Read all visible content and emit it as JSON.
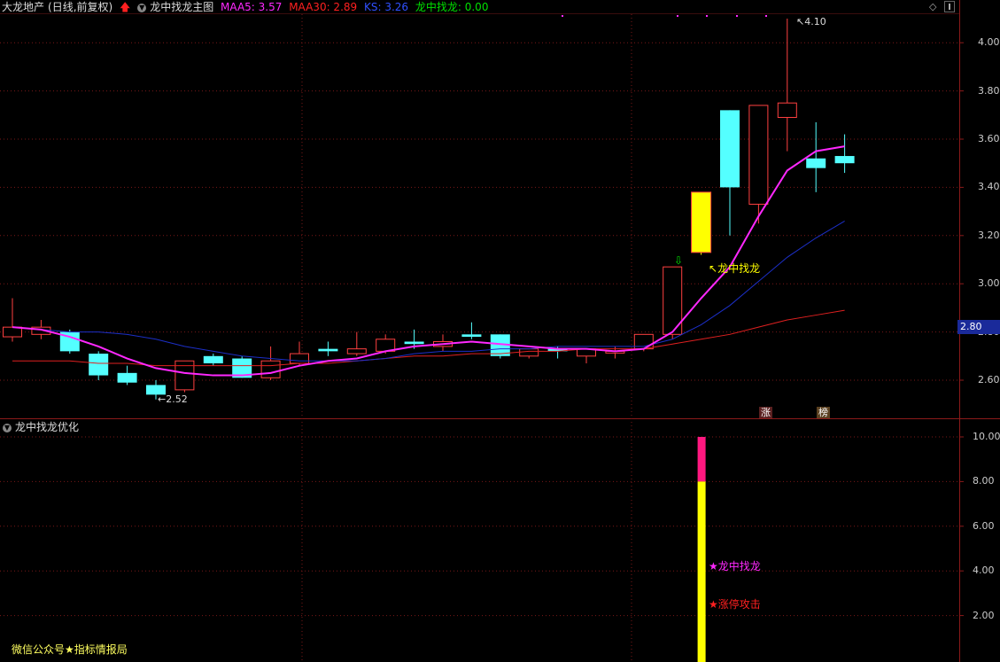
{
  "main_panel": {
    "stock_name": "大龙地产",
    "period": "(日线,前复权)",
    "indicator_name": "龙中找龙主图",
    "maa5_label": "MAA5: 3.57",
    "maa30_label": "MAA30: 2.89",
    "ks_label": "KS: 3.26",
    "signal_label": "龙中找龙: 0.00",
    "current_price_tag": "2.80",
    "annotation_high": "4.10",
    "annotation_low": "2.52",
    "signal_text": "龙中找龙",
    "badge_zhang": "涨",
    "badge_bang": "榜",
    "y_ticks": [
      "4.00",
      "3.80",
      "3.60",
      "3.40",
      "3.20",
      "3.00",
      "2.80",
      "2.60"
    ]
  },
  "sub_panel": {
    "indicator_name": "龙中找龙优化",
    "label_signal": "★龙中找龙",
    "label_limit_up": "★涨停攻击",
    "watermark": "微信公众号★指标情报局",
    "y_ticks": [
      "10.00",
      "8.00",
      "6.00",
      "4.00",
      "2.00"
    ]
  },
  "colors": {
    "up": "#ff4040",
    "down": "#54ffff",
    "maa5": "#ff28ff",
    "maa30": "#e02020",
    "ks": "#1c2fc8",
    "signal": "#00e000",
    "yellow": "#ffff00",
    "magenta_bar": "#ff1880"
  },
  "chart_data": {
    "type": "candlestick",
    "ylim": [
      2.45,
      4.15
    ],
    "candles": [
      {
        "o": 2.78,
        "c": 2.82,
        "h": 2.94,
        "l": 2.76
      },
      {
        "o": 2.79,
        "c": 2.82,
        "h": 2.85,
        "l": 2.77
      },
      {
        "o": 2.8,
        "c": 2.72,
        "h": 2.81,
        "l": 2.71
      },
      {
        "o": 2.71,
        "c": 2.62,
        "h": 2.72,
        "l": 2.6
      },
      {
        "o": 2.63,
        "c": 2.59,
        "h": 2.66,
        "l": 2.58
      },
      {
        "o": 2.58,
        "c": 2.54,
        "h": 2.6,
        "l": 2.52
      },
      {
        "o": 2.56,
        "c": 2.68,
        "h": 2.68,
        "l": 2.55
      },
      {
        "o": 2.7,
        "c": 2.67,
        "h": 2.71,
        "l": 2.66
      },
      {
        "o": 2.69,
        "c": 2.61,
        "h": 2.7,
        "l": 2.61
      },
      {
        "o": 2.61,
        "c": 2.68,
        "h": 2.74,
        "l": 2.6
      },
      {
        "o": 2.67,
        "c": 2.71,
        "h": 2.76,
        "l": 2.66
      },
      {
        "o": 2.73,
        "c": 2.72,
        "h": 2.76,
        "l": 2.7
      },
      {
        "o": 2.71,
        "c": 2.73,
        "h": 2.8,
        "l": 2.7
      },
      {
        "o": 2.72,
        "c": 2.77,
        "h": 2.79,
        "l": 2.71
      },
      {
        "o": 2.76,
        "c": 2.75,
        "h": 2.81,
        "l": 2.73
      },
      {
        "o": 2.74,
        "c": 2.76,
        "h": 2.79,
        "l": 2.72
      },
      {
        "o": 2.79,
        "c": 2.78,
        "h": 2.84,
        "l": 2.77
      },
      {
        "o": 2.79,
        "c": 2.7,
        "h": 2.79,
        "l": 2.69
      },
      {
        "o": 2.7,
        "c": 2.73,
        "h": 2.73,
        "l": 2.69
      },
      {
        "o": 2.73,
        "c": 2.72,
        "h": 2.74,
        "l": 2.69
      },
      {
        "o": 2.7,
        "c": 2.73,
        "h": 2.73,
        "l": 2.67
      },
      {
        "o": 2.72,
        "c": 2.72,
        "h": 2.74,
        "l": 2.69
      },
      {
        "o": 2.73,
        "c": 2.79,
        "h": 2.79,
        "l": 2.72
      },
      {
        "o": 2.79,
        "c": 3.07,
        "h": 3.07,
        "l": 2.77
      },
      {
        "o": 3.13,
        "c": 3.38,
        "h": 3.38,
        "l": 3.12
      },
      {
        "o": 3.72,
        "c": 3.4,
        "h": 3.72,
        "l": 3.2
      },
      {
        "o": 3.33,
        "c": 3.74,
        "h": 3.74,
        "l": 3.25
      },
      {
        "o": 3.69,
        "c": 3.75,
        "h": 4.1,
        "l": 3.55
      },
      {
        "o": 3.52,
        "c": 3.48,
        "h": 3.67,
        "l": 3.38
      },
      {
        "o": 3.53,
        "c": 3.5,
        "h": 3.62,
        "l": 3.46
      }
    ],
    "maa5": [
      2.82,
      2.81,
      2.78,
      2.74,
      2.69,
      2.65,
      2.63,
      2.62,
      2.62,
      2.63,
      2.66,
      2.68,
      2.69,
      2.72,
      2.74,
      2.75,
      2.76,
      2.75,
      2.74,
      2.73,
      2.73,
      2.72,
      2.73,
      2.8,
      2.94,
      3.07,
      3.28,
      3.47,
      3.55,
      3.57
    ],
    "maa30": [
      2.68,
      2.68,
      2.68,
      2.67,
      2.67,
      2.66,
      2.66,
      2.66,
      2.66,
      2.66,
      2.67,
      2.67,
      2.68,
      2.69,
      2.7,
      2.7,
      2.71,
      2.71,
      2.72,
      2.72,
      2.73,
      2.73,
      2.73,
      2.75,
      2.77,
      2.79,
      2.82,
      2.85,
      2.87,
      2.89
    ],
    "ks": [
      2.82,
      2.81,
      2.8,
      2.8,
      2.79,
      2.77,
      2.74,
      2.72,
      2.7,
      2.69,
      2.68,
      2.68,
      2.68,
      2.69,
      2.71,
      2.72,
      2.72,
      2.73,
      2.73,
      2.74,
      2.74,
      2.74,
      2.74,
      2.77,
      2.83,
      2.91,
      3.01,
      3.11,
      3.19,
      3.26
    ],
    "sub_bar": {
      "index": 24,
      "yellow_value": 8,
      "total_value": 10
    },
    "sub_ylim": [
      0,
      10.5
    ]
  }
}
